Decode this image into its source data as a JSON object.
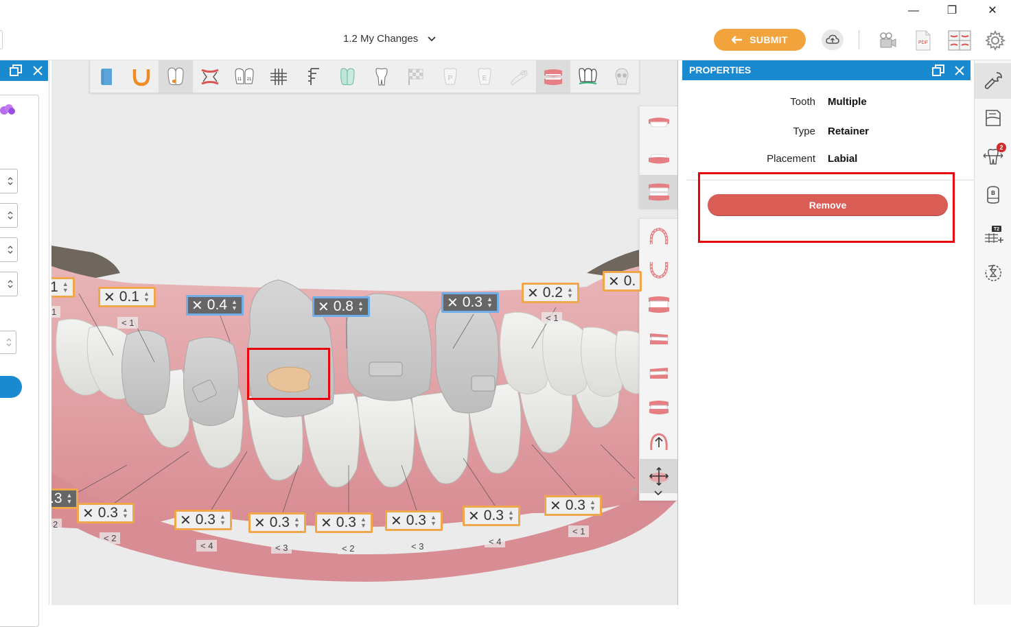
{
  "window": {
    "minimize": "—",
    "restore": "❐",
    "close": "✕"
  },
  "header": {
    "version_label": "1.2 My Changes",
    "submit_label": "SUBMIT"
  },
  "properties": {
    "title": "PROPERTIES",
    "rows": [
      {
        "key": "Tooth",
        "value": "Multiple"
      },
      {
        "key": "Type",
        "value": "Retainer"
      },
      {
        "key": "Placement",
        "value": "Labial"
      }
    ],
    "remove_label": "Remove"
  },
  "right_rail": {
    "badge_count": "2",
    "bolton_label": "B",
    "t2_label": "T2"
  },
  "viewport": {
    "toolbar_labels": {
      "tooth_numbers": [
        "11",
        "21"
      ],
      "p": "P",
      "e": "E"
    },
    "upper_measurements": [
      {
        "text": "1",
        "style": "orange"
      },
      {
        "text": "0.1",
        "style": "orange"
      },
      {
        "text": "0.4",
        "style": "blue"
      },
      {
        "text": "0.8",
        "style": "blue"
      },
      {
        "text": "0.3",
        "style": "blue"
      },
      {
        "text": "0.2",
        "style": "orange"
      },
      {
        "text": "0.",
        "style": "orange"
      }
    ],
    "upper_limits": [
      "< 1",
      "< 1",
      "1"
    ],
    "lower_measurements": [
      {
        "text": ".3",
        "style": "dark"
      },
      {
        "text": "0.3",
        "style": "orange"
      },
      {
        "text": "0.3",
        "style": "orange"
      },
      {
        "text": "0.3",
        "style": "orange"
      },
      {
        "text": "0.3",
        "style": "orange"
      },
      {
        "text": "0.3",
        "style": "orange"
      },
      {
        "text": "0.3",
        "style": "orange"
      },
      {
        "text": "0.3",
        "style": "orange"
      }
    ],
    "lower_limits": [
      "2",
      "< 2",
      "< 4",
      "< 3",
      "< 2",
      "< 3",
      "< 4",
      "< 1"
    ]
  },
  "colors": {
    "accent_blue": "#1a8ad0",
    "submit_orange": "#f3a33b",
    "remove_red": "#d95d55",
    "highlight_red": "#e8000b"
  }
}
